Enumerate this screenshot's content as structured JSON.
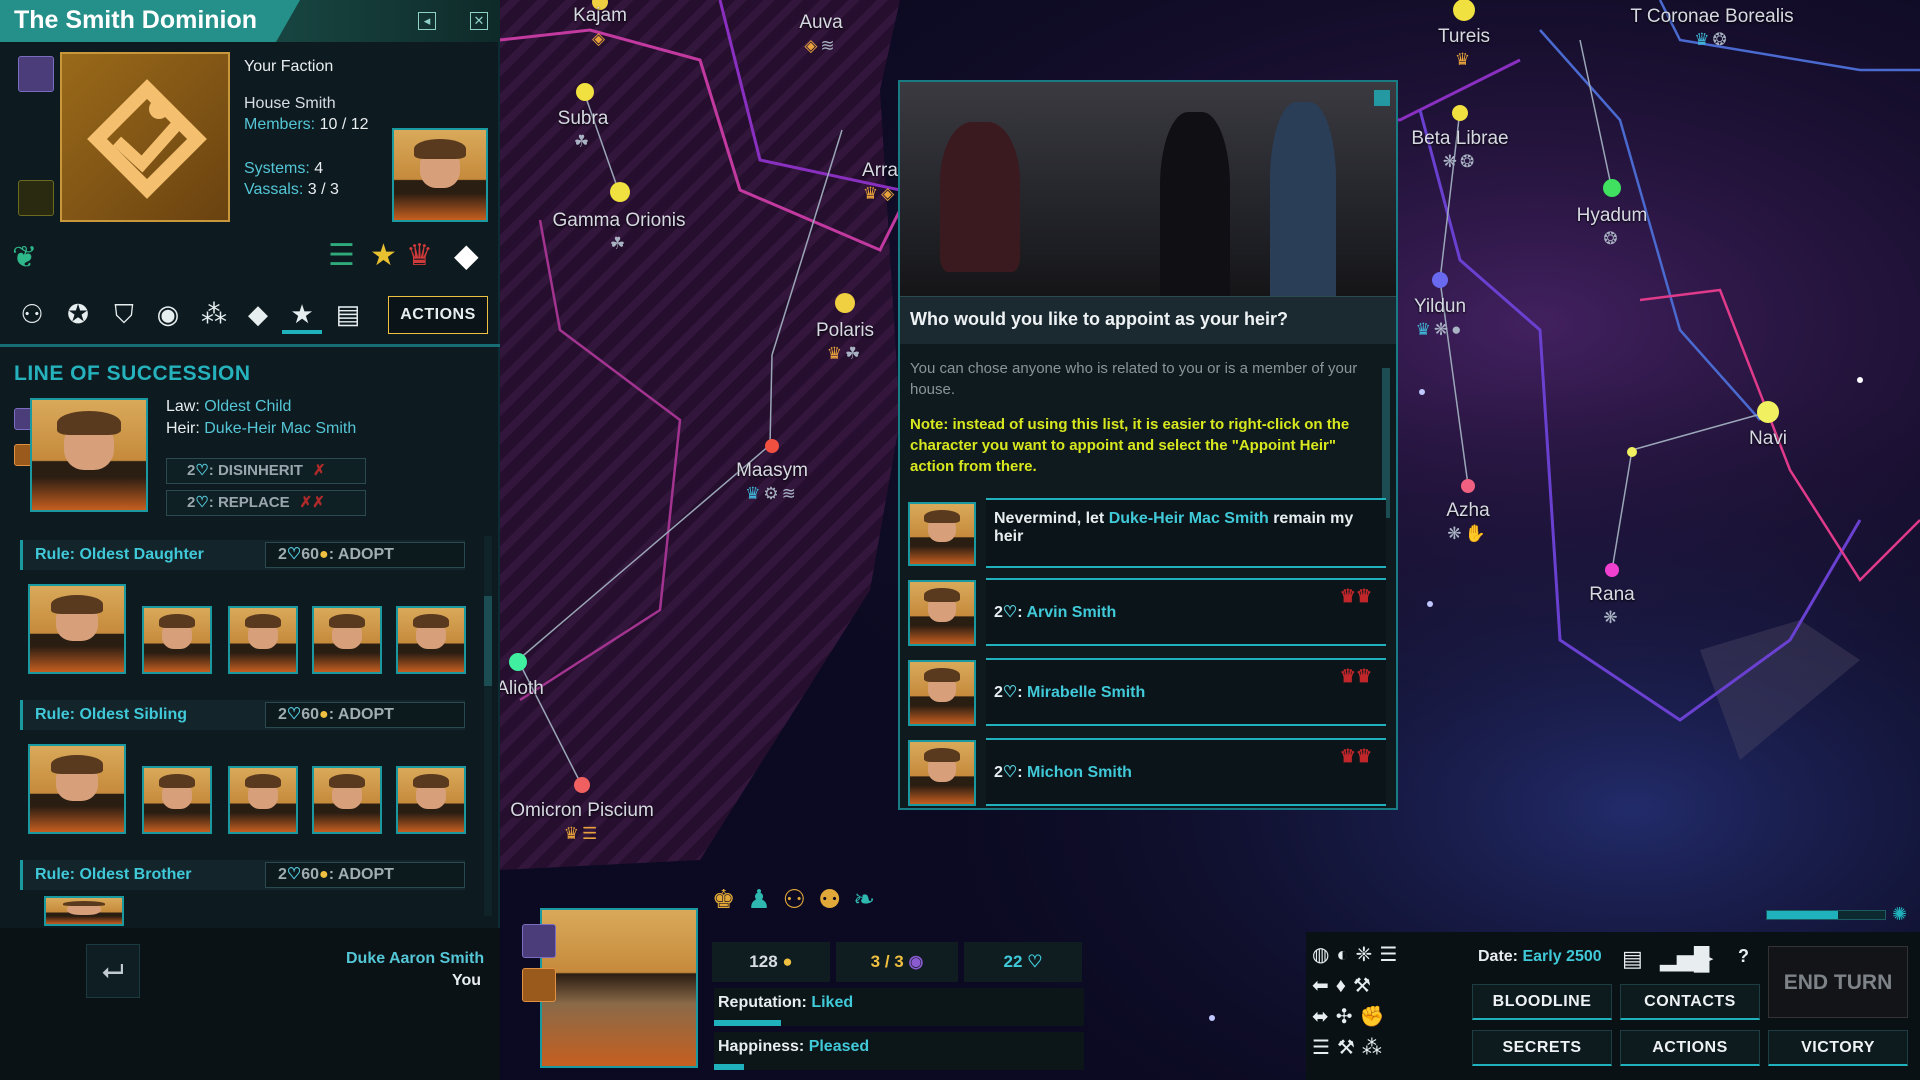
{
  "faction": {
    "title": "The Smith Dominion",
    "your_faction_label": "Your Faction",
    "house_name": "House Smith",
    "members_label": "Members: ",
    "members_value": "10 / 12",
    "systems_label": "Systems: ",
    "systems_value": "4",
    "vassals_label": "Vassals: ",
    "vassals_value": "3 / 3",
    "actions_label": "ACTIONS"
  },
  "succession": {
    "title": "LINE OF SUCCESSION",
    "law_label": "Law: ",
    "law_value": "Oldest Child",
    "heir_label": "Heir: ",
    "heir_value": "Duke-Heir Mac Smith",
    "disinherit_label": "DISINHERIT",
    "disinherit_cost": "2",
    "replace_label": "REPLACE",
    "replace_cost": "2",
    "rules": [
      {
        "label": "Rule: Oldest Daughter",
        "cost": "2",
        "cost2": "60",
        "action": "ADOPT"
      },
      {
        "label": "Rule: Oldest Sibling",
        "cost": "2",
        "cost2": "60",
        "action": "ADOPT"
      },
      {
        "label": "Rule: Oldest Brother",
        "cost": "2",
        "cost2": "60",
        "action": "ADOPT"
      }
    ]
  },
  "ruler": {
    "name": "Duke Aaron Smith",
    "you": "You"
  },
  "dialog": {
    "question": "Who would you like to appoint as your heir?",
    "intro": "You can chose anyone who is related to you or is a member of your house.",
    "note": "Note: instead of using this list, it is easier to right-click on the character you want to appoint and select the \"Appoint Heir\" action from there.",
    "nevermind_pre": "Nevermind, let ",
    "nevermind_name": "Duke-Heir Mac Smith",
    "nevermind_post": " remain my heir",
    "choices": [
      {
        "cost": "2",
        "name": "Arvin Smith"
      },
      {
        "cost": "2",
        "name": "Mirabelle Smith"
      },
      {
        "cost": "2",
        "name": "Michon Smith"
      }
    ]
  },
  "resources": {
    "credits": "128",
    "vassals": "3 / 3",
    "influence": "22",
    "reputation_label": "Reputation: ",
    "reputation_value": "Liked",
    "reputation_fill": 0.18,
    "happiness_label": "Happiness: ",
    "happiness_value": "Pleased",
    "happiness_fill": 0.08
  },
  "turn": {
    "date_label": "Date: ",
    "date_value": "Early 2500",
    "end_turn": "END TURN",
    "progress": 0.6
  },
  "menu": {
    "bloodline": "BLOODLINE",
    "contacts": "CONTACTS",
    "secrets": "SECRETS",
    "actions": "ACTIONS",
    "victory": "VICTORY",
    "help": "?"
  },
  "systems": [
    "Kajam",
    "Auva",
    "Subra",
    "Gamma Orionis",
    "Polaris",
    "Maasym",
    "Alioth",
    "Omicron Piscium",
    "Tureis",
    "T Coronae Borealis",
    "Beta Librae",
    "Hyadum",
    "Yildun",
    "Azha",
    "Navi",
    "Rana",
    "Arra"
  ],
  "colors": {
    "accent": "#1fb1bc",
    "title_bar": "#25908a",
    "heir_link": "#40c9d8",
    "note": "#d8e81e",
    "actions_border": "#f0c040"
  }
}
